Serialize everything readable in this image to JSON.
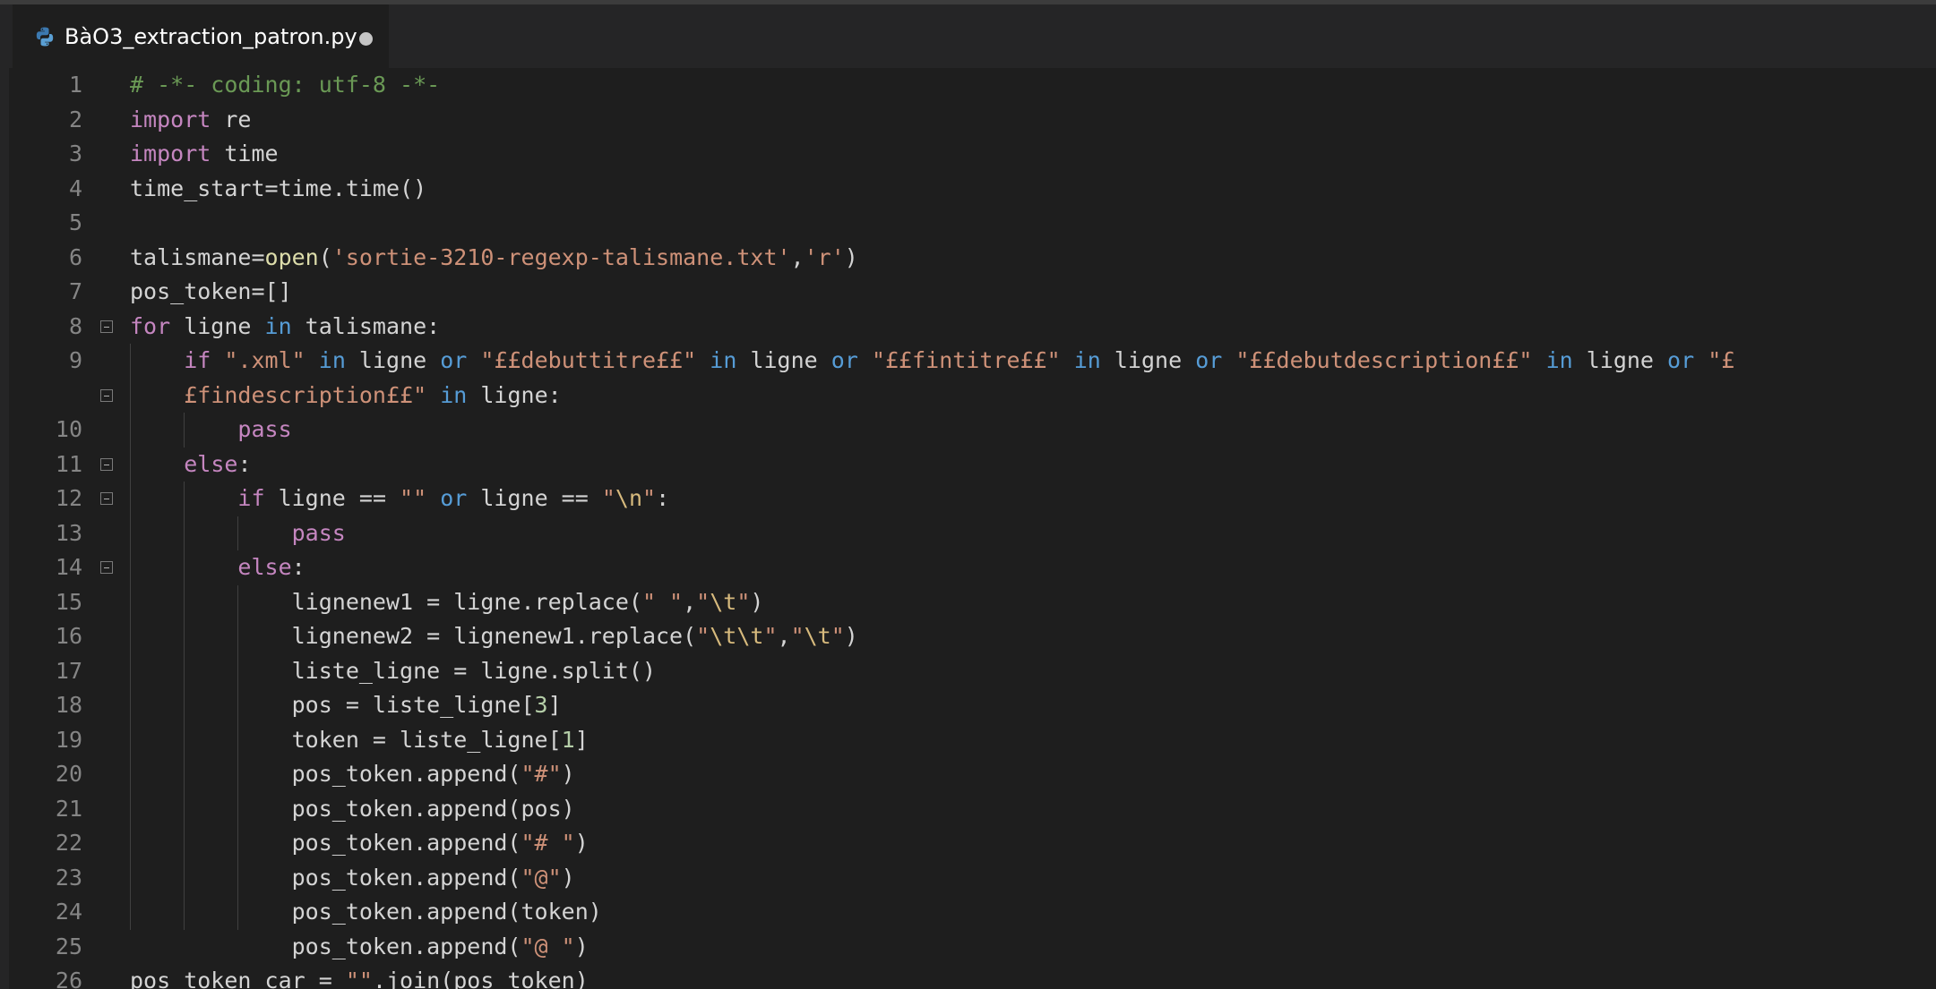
{
  "tab": {
    "title": "BàO3_extraction_patron.py",
    "icon": "python-icon",
    "modified": true
  },
  "colors": {
    "background": "#1e1e1e",
    "comment": "#6a9955",
    "keyword": "#c586c0",
    "operator_keyword": "#569cd6",
    "string": "#ce9178",
    "escape": "#d7ba7d",
    "number": "#b5cea8",
    "function": "#dcdcaa",
    "text": "#d4d4d4",
    "line_number": "#858585"
  },
  "lines": [
    {
      "num": "1",
      "fold": false,
      "tokens": [
        [
          "# -*- coding: utf-8 -*-",
          "comment"
        ]
      ]
    },
    {
      "num": "2",
      "fold": false,
      "tokens": [
        [
          "import",
          "kw"
        ],
        [
          " re",
          "text"
        ]
      ]
    },
    {
      "num": "3",
      "fold": false,
      "tokens": [
        [
          "import",
          "kw"
        ],
        [
          " time",
          "text"
        ]
      ]
    },
    {
      "num": "4",
      "fold": false,
      "tokens": [
        [
          "time_start=time.time()",
          "text"
        ]
      ]
    },
    {
      "num": "5",
      "fold": false,
      "tokens": []
    },
    {
      "num": "6",
      "fold": false,
      "tokens": [
        [
          "talismane=",
          "text"
        ],
        [
          "open",
          "fn"
        ],
        [
          "(",
          "text"
        ],
        [
          "'sortie-3210-regexp-talismane.txt'",
          "str"
        ],
        [
          ",",
          "text"
        ],
        [
          "'r'",
          "str"
        ],
        [
          ")",
          "text"
        ]
      ]
    },
    {
      "num": "7",
      "fold": false,
      "tokens": [
        [
          "pos_token=[]",
          "text"
        ]
      ]
    },
    {
      "num": "8",
      "fold": true,
      "tokens": [
        [
          "for",
          "kw"
        ],
        [
          " ligne ",
          "text"
        ],
        [
          "in",
          "op"
        ],
        [
          " talismane:",
          "text"
        ]
      ]
    },
    {
      "num": "9",
      "fold": false,
      "tokens": [
        [
          "    ",
          "text"
        ],
        [
          "if",
          "kw"
        ],
        [
          " ",
          "text"
        ],
        [
          "\".xml\"",
          "str"
        ],
        [
          " ",
          "text"
        ],
        [
          "in",
          "op"
        ],
        [
          " ligne ",
          "text"
        ],
        [
          "or",
          "op"
        ],
        [
          " ",
          "text"
        ],
        [
          "\"££debuttitre££\"",
          "str"
        ],
        [
          " ",
          "text"
        ],
        [
          "in",
          "op"
        ],
        [
          " ligne ",
          "text"
        ],
        [
          "or",
          "op"
        ],
        [
          " ",
          "text"
        ],
        [
          "\"££fintitre££\"",
          "str"
        ],
        [
          " ",
          "text"
        ],
        [
          "in",
          "op"
        ],
        [
          " ligne ",
          "text"
        ],
        [
          "or",
          "op"
        ],
        [
          " ",
          "text"
        ],
        [
          "\"££debutdescription££\"",
          "str"
        ],
        [
          " ",
          "text"
        ],
        [
          "in",
          "op"
        ],
        [
          " ligne ",
          "text"
        ],
        [
          "or",
          "op"
        ],
        [
          " ",
          "text"
        ],
        [
          "\"£",
          "str"
        ]
      ]
    },
    {
      "num": "",
      "fold": true,
      "tokens": [
        [
          "    ",
          "text"
        ],
        [
          "£findescription££\"",
          "str"
        ],
        [
          " ",
          "text"
        ],
        [
          "in",
          "op"
        ],
        [
          " ligne:",
          "text"
        ]
      ]
    },
    {
      "num": "10",
      "fold": false,
      "tokens": [
        [
          "        ",
          "text"
        ],
        [
          "pass",
          "kw"
        ]
      ]
    },
    {
      "num": "11",
      "fold": true,
      "tokens": [
        [
          "    ",
          "text"
        ],
        [
          "else",
          "kw"
        ],
        [
          ":",
          "text"
        ]
      ]
    },
    {
      "num": "12",
      "fold": true,
      "tokens": [
        [
          "        ",
          "text"
        ],
        [
          "if",
          "kw"
        ],
        [
          " ligne == ",
          "text"
        ],
        [
          "\"\"",
          "str"
        ],
        [
          " ",
          "text"
        ],
        [
          "or",
          "op"
        ],
        [
          " ligne == ",
          "text"
        ],
        [
          "\"",
          "str"
        ],
        [
          "\\n",
          "esc"
        ],
        [
          "\"",
          "str"
        ],
        [
          ":",
          "text"
        ]
      ]
    },
    {
      "num": "13",
      "fold": false,
      "tokens": [
        [
          "            ",
          "text"
        ],
        [
          "pass",
          "kw"
        ]
      ]
    },
    {
      "num": "14",
      "fold": true,
      "tokens": [
        [
          "        ",
          "text"
        ],
        [
          "else",
          "kw"
        ],
        [
          ":",
          "text"
        ]
      ]
    },
    {
      "num": "15",
      "fold": false,
      "tokens": [
        [
          "            lignenew1 = ligne.replace(",
          "text"
        ],
        [
          "\" \"",
          "str"
        ],
        [
          ",",
          "text"
        ],
        [
          "\"",
          "str"
        ],
        [
          "\\t",
          "esc"
        ],
        [
          "\"",
          "str"
        ],
        [
          ")",
          "text"
        ]
      ]
    },
    {
      "num": "16",
      "fold": false,
      "tokens": [
        [
          "            lignenew2 = lignenew1.replace(",
          "text"
        ],
        [
          "\"",
          "str"
        ],
        [
          "\\t\\t",
          "esc"
        ],
        [
          "\"",
          "str"
        ],
        [
          ",",
          "text"
        ],
        [
          "\"",
          "str"
        ],
        [
          "\\t",
          "esc"
        ],
        [
          "\"",
          "str"
        ],
        [
          ")",
          "text"
        ]
      ]
    },
    {
      "num": "17",
      "fold": false,
      "tokens": [
        [
          "            liste_ligne = ligne.split()",
          "text"
        ]
      ]
    },
    {
      "num": "18",
      "fold": false,
      "tokens": [
        [
          "            pos = liste_ligne[",
          "text"
        ],
        [
          "3",
          "num"
        ],
        [
          "]",
          "text"
        ]
      ]
    },
    {
      "num": "19",
      "fold": false,
      "tokens": [
        [
          "            token = liste_ligne[",
          "text"
        ],
        [
          "1",
          "num"
        ],
        [
          "]",
          "text"
        ]
      ]
    },
    {
      "num": "20",
      "fold": false,
      "tokens": [
        [
          "            pos_token.append(",
          "text"
        ],
        [
          "\"#\"",
          "str"
        ],
        [
          ")",
          "text"
        ]
      ]
    },
    {
      "num": "21",
      "fold": false,
      "tokens": [
        [
          "            pos_token.append(pos)",
          "text"
        ]
      ]
    },
    {
      "num": "22",
      "fold": false,
      "tokens": [
        [
          "            pos_token.append(",
          "text"
        ],
        [
          "\"# \"",
          "str"
        ],
        [
          ")",
          "text"
        ]
      ]
    },
    {
      "num": "23",
      "fold": false,
      "tokens": [
        [
          "            pos_token.append(",
          "text"
        ],
        [
          "\"@\"",
          "str"
        ],
        [
          ")",
          "text"
        ]
      ]
    },
    {
      "num": "24",
      "fold": false,
      "tokens": [
        [
          "            pos_token.append(token)",
          "text"
        ]
      ]
    },
    {
      "num": "25",
      "fold": false,
      "tokens": [
        [
          "            pos_token.append(",
          "text"
        ],
        [
          "\"@ \"",
          "str"
        ],
        [
          ")",
          "text"
        ]
      ]
    },
    {
      "num": "26",
      "fold": false,
      "tokens": [
        [
          "pos_token_car = ",
          "text"
        ],
        [
          "\"\"",
          "str"
        ],
        [
          ".join(pos_token)",
          "text"
        ]
      ]
    }
  ]
}
